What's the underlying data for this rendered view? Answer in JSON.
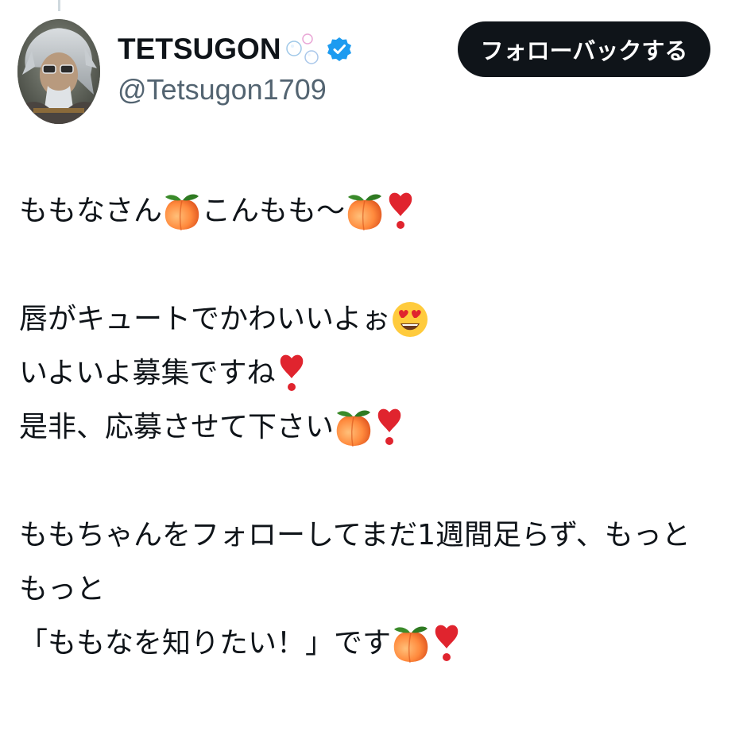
{
  "tweet": {
    "author": {
      "display_name": "TETSUGON",
      "handle": "@Tetsugon1709",
      "verified": true,
      "name_decoration": "bubbles-icon",
      "accent_color": "#1d9bf0"
    },
    "follow_button": {
      "label": "フォローバックする",
      "background": "#0f1419",
      "text_color": "#ffffff"
    },
    "body": {
      "line1_a": "ももなさん",
      "line1_b": "こんもも〜",
      "line2": "唇がキュートでかわいいよぉ",
      "line3": "いよいよ募集ですね",
      "line4": "是非、応募させて下さい",
      "line5": "ももちゃんをフォローしてまだ1週間足らず、もっと",
      "line6": "もっと",
      "line7": "「ももなを知りたい！」です"
    },
    "emoji_names": [
      "peach-emoji",
      "red-exclamation-emoji",
      "heart-eyes-emoji"
    ]
  }
}
